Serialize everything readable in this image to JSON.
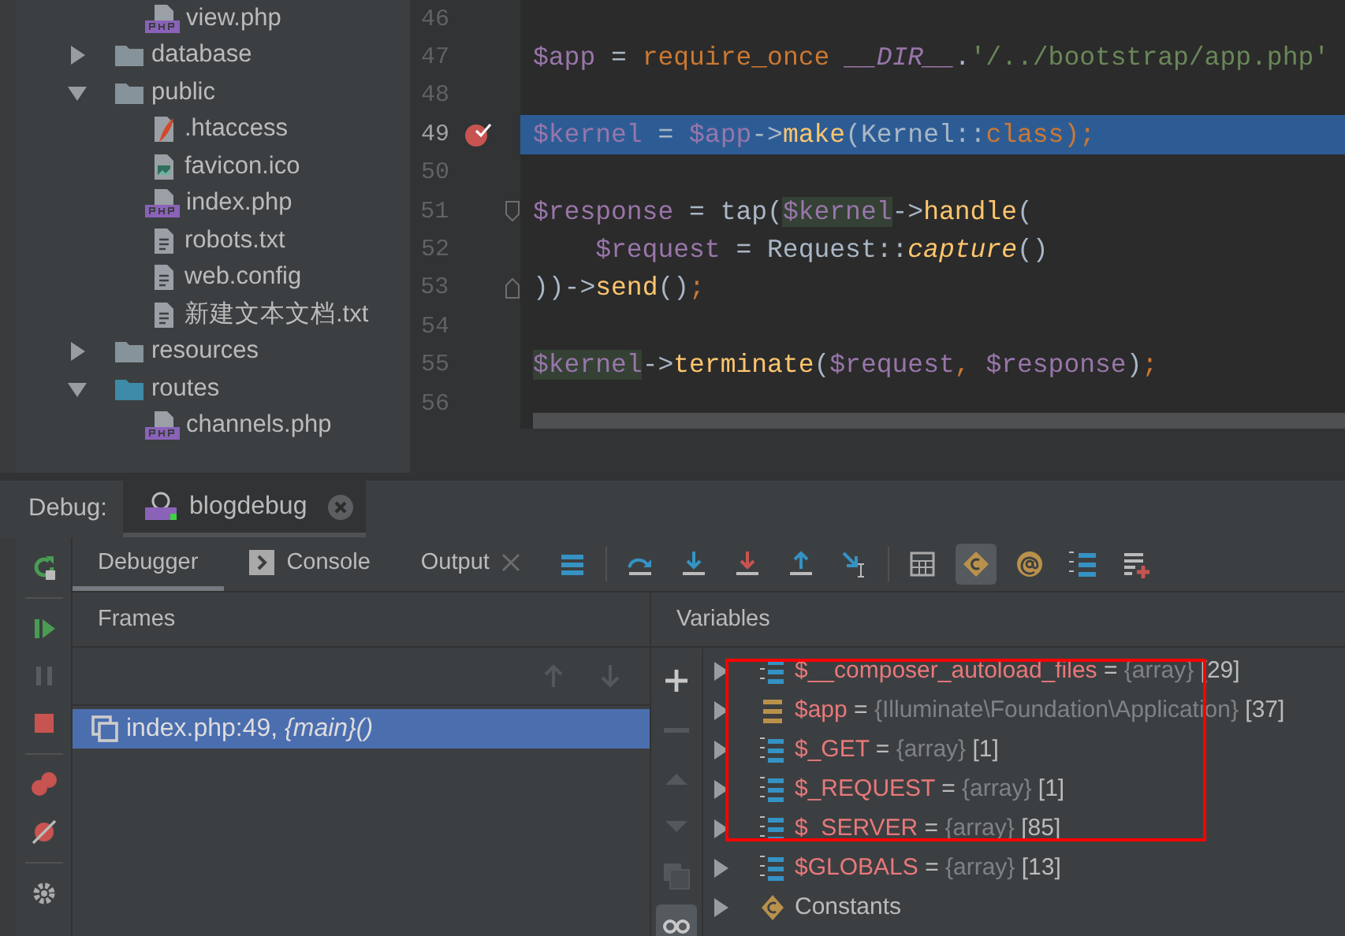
{
  "project_tree": {
    "continued_children": [
      {
        "name": "view.php",
        "kind": "php"
      }
    ],
    "items": [
      {
        "name": "database",
        "kind": "folder",
        "expanded": false,
        "color": "#87939a"
      },
      {
        "name": "public",
        "kind": "folder",
        "expanded": true,
        "color": "#87939a",
        "children": [
          {
            "name": ".htaccess",
            "kind": "apache"
          },
          {
            "name": "favicon.ico",
            "kind": "image"
          },
          {
            "name": "index.php",
            "kind": "php"
          },
          {
            "name": "robots.txt",
            "kind": "text"
          },
          {
            "name": "web.config",
            "kind": "text"
          },
          {
            "name": "新建文本文档.txt",
            "kind": "text"
          }
        ]
      },
      {
        "name": "resources",
        "kind": "folder",
        "expanded": false,
        "color": "#87939a"
      },
      {
        "name": "routes",
        "kind": "folder",
        "expanded": true,
        "color": "#3d8ba6",
        "children": [
          {
            "name": "channels.php",
            "kind": "php"
          }
        ]
      }
    ]
  },
  "editor": {
    "lines": [
      {
        "number": "46",
        "current": false,
        "breakpoint": false,
        "fold_start": false,
        "fold_end": false
      },
      {
        "number": "47",
        "current": false,
        "breakpoint": false,
        "fold_start": false,
        "fold_end": false,
        "tokens": [
          {
            "text": "$app",
            "kind": "var"
          },
          {
            "text": " = ",
            "kind": "plain"
          },
          {
            "text": "require_once ",
            "kind": "kw"
          },
          {
            "text": "__DIR__",
            "kind": "const"
          },
          {
            "text": ".",
            "kind": "plain"
          },
          {
            "text": "'/../bootstrap/app.php'",
            "kind": "str"
          }
        ]
      },
      {
        "number": "48",
        "current": false,
        "breakpoint": false,
        "fold_start": false,
        "fold_end": false
      },
      {
        "number": "49",
        "current": true,
        "breakpoint": true,
        "fold_start": false,
        "fold_end": false,
        "tokens": [
          {
            "text": "$kernel",
            "kind": "var"
          },
          {
            "text": " = ",
            "kind": "plain"
          },
          {
            "text": "$app",
            "kind": "var"
          },
          {
            "text": "->",
            "kind": "plain"
          },
          {
            "text": "make",
            "kind": "fn"
          },
          {
            "text": "(Kernel::",
            "kind": "plain"
          },
          {
            "text": "class",
            "kind": "kw"
          },
          {
            "text": ");",
            "kind": "kw"
          }
        ]
      },
      {
        "number": "50",
        "current": false,
        "breakpoint": false,
        "fold_start": false,
        "fold_end": false
      },
      {
        "number": "51",
        "current": false,
        "breakpoint": false,
        "fold_start": true,
        "fold_end": false,
        "tokens": [
          {
            "text": "$response",
            "kind": "var"
          },
          {
            "text": " = tap(",
            "kind": "plain"
          },
          {
            "text": "$kernel",
            "kind": "var_hl"
          },
          {
            "text": "->",
            "kind": "plain"
          },
          {
            "text": "handle",
            "kind": "fn"
          },
          {
            "text": "(",
            "kind": "plain"
          }
        ]
      },
      {
        "number": "52",
        "current": false,
        "breakpoint": false,
        "fold_start": false,
        "fold_end": false,
        "tokens": [
          {
            "text": "    $request",
            "kind": "var"
          },
          {
            "text": " = Request::",
            "kind": "plain"
          },
          {
            "text": "capture",
            "kind": "fn_italic"
          },
          {
            "text": "()",
            "kind": "plain"
          }
        ]
      },
      {
        "number": "53",
        "current": false,
        "breakpoint": false,
        "fold_start": false,
        "fold_end": true,
        "tokens": [
          {
            "text": "))->",
            "kind": "plain"
          },
          {
            "text": "send",
            "kind": "fn"
          },
          {
            "text": "()",
            "kind": "plain"
          },
          {
            "text": ";",
            "kind": "kw"
          }
        ]
      },
      {
        "number": "54",
        "current": false,
        "breakpoint": false,
        "fold_start": false,
        "fold_end": false
      },
      {
        "number": "55",
        "current": false,
        "breakpoint": false,
        "fold_start": false,
        "fold_end": false,
        "tokens": [
          {
            "text": "$kernel",
            "kind": "var_hl"
          },
          {
            "text": "->",
            "kind": "plain"
          },
          {
            "text": "terminate",
            "kind": "fn"
          },
          {
            "text": "(",
            "kind": "plain"
          },
          {
            "text": "$request",
            "kind": "var"
          },
          {
            "text": ", ",
            "kind": "kw"
          },
          {
            "text": "$response",
            "kind": "var"
          },
          {
            "text": ")",
            "kind": "plain"
          },
          {
            "text": ";",
            "kind": "kw"
          }
        ]
      },
      {
        "number": "56",
        "current": false,
        "breakpoint": false,
        "fold_start": false,
        "fold_end": false
      }
    ]
  },
  "debug": {
    "label": "Debug:",
    "session": {
      "name": "blogdebug"
    },
    "tabs": [
      {
        "label": "Debugger",
        "selected": true,
        "kind": "plain"
      },
      {
        "label": "Console",
        "selected": false,
        "kind": "console"
      },
      {
        "label": "Output",
        "selected": false,
        "kind": "closable"
      }
    ],
    "constants_toggle": {
      "on": true
    },
    "watches_toggle": {
      "on": true
    },
    "frames": {
      "title": "Frames",
      "items": [
        {
          "text": "index.php:49, *{main}()*",
          "selected": true
        }
      ]
    },
    "variables": {
      "title": "Variables",
      "items": [
        {
          "kind": "array",
          "name": "$__composer_autoload_files",
          "equals": "=",
          "type": "{array}",
          "count": "[29]"
        },
        {
          "kind": "object",
          "name": "$app",
          "equals": "=",
          "type": "{Illuminate\\Foundation\\Application}",
          "count": "[37]"
        },
        {
          "kind": "array",
          "name": "$_GET",
          "equals": "=",
          "type": "{array}",
          "count": "[1]"
        },
        {
          "kind": "array",
          "name": "$_REQUEST",
          "equals": "=",
          "type": "{array}",
          "count": "[1]"
        },
        {
          "kind": "array",
          "name": "$_SERVER",
          "equals": "=",
          "type": "{array}",
          "count": "[85]"
        },
        {
          "kind": "array",
          "name": "$GLOBALS",
          "equals": "=",
          "type": "{array}",
          "count": "[13]"
        },
        {
          "kind": "constants",
          "name": "Constants"
        }
      ]
    }
  }
}
